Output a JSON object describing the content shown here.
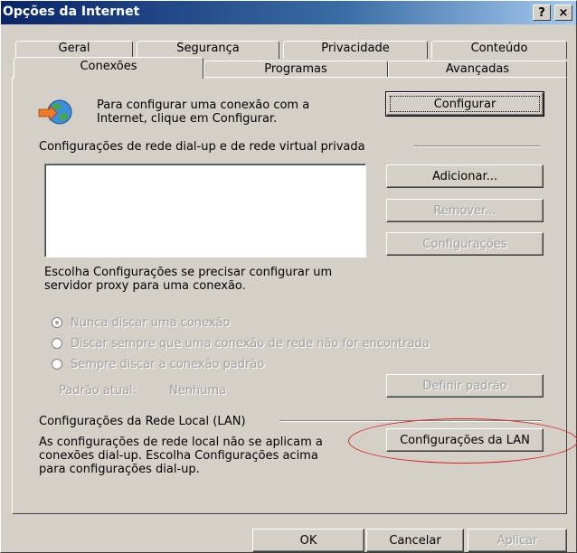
{
  "window": {
    "title": "Opções da Internet",
    "help_label": "?",
    "close_label": "×"
  },
  "tabs": {
    "row1": [
      "Geral",
      "Segurança",
      "Privacidade",
      "Conteúdo"
    ],
    "row2": [
      "Conexões",
      "Programas",
      "Avançadas"
    ],
    "active": "Conexões"
  },
  "setup": {
    "text_line1": "Para configurar uma conexão com a",
    "text_line2": "Internet, clique em Configurar.",
    "button_label": "Configurar"
  },
  "dialup": {
    "group_label": "Configurações de rede dial-up e de rede virtual privada",
    "connections": [],
    "add_label": "Adicionar...",
    "remove_label": "Remover...",
    "settings_label": "Configurações",
    "proxy_text_line1": "Escolha Configurações se precisar configurar um",
    "proxy_text_line2": "servidor proxy para uma conexão.",
    "options": [
      {
        "label": "Nunca discar uma conexão",
        "checked": true
      },
      {
        "label": "Discar sempre que uma conexão de rede não for encontrada",
        "checked": false
      },
      {
        "label": "Sempre discar a conexão padrão",
        "checked": false
      }
    ],
    "current_default_label": "Padrão atual:",
    "current_default_value": "Nenhuma",
    "set_default_label": "Definir padrão"
  },
  "lan": {
    "group_label": "Configurações da Rede Local (LAN)",
    "text_line1": "As configurações de rede local não se aplicam a",
    "text_line2": "conexões dial-up. Escolha Configurações acima",
    "text_line3": "para configurações dial-up.",
    "button_label": "Configurações da LAN"
  },
  "footer": {
    "ok_label": "OK",
    "cancel_label": "Cancelar",
    "apply_label": "Aplicar"
  },
  "colors": {
    "highlight_circle": "#e02020",
    "titlebar_start": "#0a246a",
    "face": "#d4d0c8"
  },
  "icons": {
    "connection": "globe-arrow-icon"
  }
}
